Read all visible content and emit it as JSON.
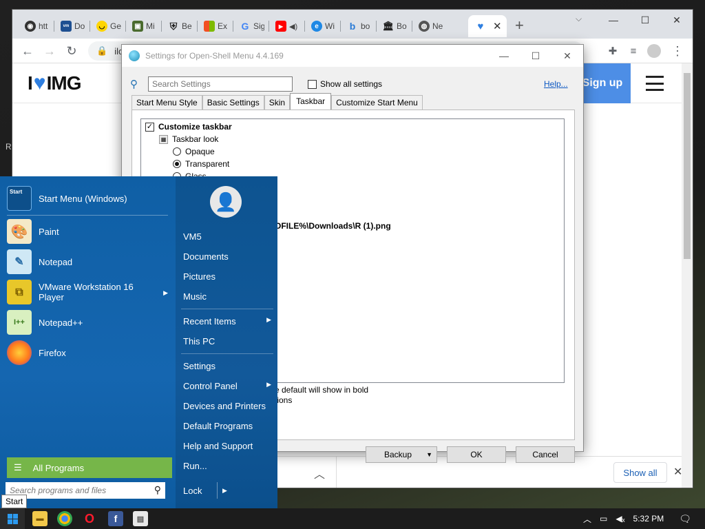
{
  "desktop": {
    "edge_text": "R"
  },
  "browser": {
    "tabs": [
      {
        "icon": "github-icon",
        "title": "htt"
      },
      {
        "icon": "vmware-icon",
        "title": "Do"
      },
      {
        "icon": "smile-icon",
        "title": "Ge"
      },
      {
        "icon": "minecraft-icon",
        "title": "Mi"
      },
      {
        "icon": "shield-icon",
        "title": "Be"
      },
      {
        "icon": "microsoft-icon",
        "title": "Ex"
      },
      {
        "icon": "google-icon",
        "title": "Sig"
      },
      {
        "icon": "youtube-icon",
        "title": ""
      },
      {
        "icon": "edge-icon",
        "title": "Wi"
      },
      {
        "icon": "bing-icon",
        "title": "bo"
      },
      {
        "icon": "bank-icon",
        "title": "Bo"
      },
      {
        "icon": "globe-icon",
        "title": "Ne"
      },
      {
        "icon": "heart-icon",
        "title": ""
      }
    ],
    "address": "ilo",
    "site": {
      "logo_left": "I",
      "logo_right": "IMG",
      "signup": "Sign up"
    },
    "downloads": {
      "show_all": "Show all"
    }
  },
  "dialog": {
    "title": "Settings for Open-Shell Menu 4.4.169",
    "search_placeholder": "Search Settings",
    "show_all_label": "Show all settings",
    "help": "Help...",
    "tabs": [
      "Start Menu Style",
      "Basic Settings",
      "Skin",
      "Taskbar",
      "Customize Start Menu"
    ],
    "active_tab": "Taskbar",
    "tree": {
      "customize": "Customize taskbar",
      "look": "Taskbar look",
      "opaque": "Opaque",
      "transparent": "Transparent",
      "glass": "Glass",
      "path": "OFILE%\\Downloads\\R (1).png"
    },
    "hint1": "e default will show in bold",
    "hint2": "tions",
    "buttons": {
      "backup": "Backup",
      "ok": "OK",
      "cancel": "Cancel"
    }
  },
  "start_menu": {
    "pinned": [
      {
        "label": "Start Menu (Windows)",
        "icon": "start-tile-icon"
      },
      {
        "label": "Paint",
        "icon": "paint-icon"
      },
      {
        "label": "Notepad",
        "icon": "notepad-icon"
      },
      {
        "label": "VMware Workstation 16\nPlayer",
        "icon": "vmware-icon"
      },
      {
        "label": "Notepad++",
        "icon": "notepadpp-icon"
      },
      {
        "label": "Firefox",
        "icon": "firefox-icon"
      }
    ],
    "start_tile_text": "Start",
    "all_programs": "All Programs",
    "search_placeholder": "Search programs and files",
    "right": {
      "user": "VM5",
      "documents": "Documents",
      "pictures": "Pictures",
      "music": "Music",
      "recent": "Recent Items",
      "thispc": "This PC",
      "settings": "Settings",
      "control": "Control Panel",
      "devices": "Devices and Printers",
      "defaults": "Default Programs",
      "help": "Help and Support",
      "run": "Run...",
      "lock": "Lock"
    }
  },
  "tooltip": "Start",
  "taskbar": {
    "time": "5:32 PM"
  }
}
